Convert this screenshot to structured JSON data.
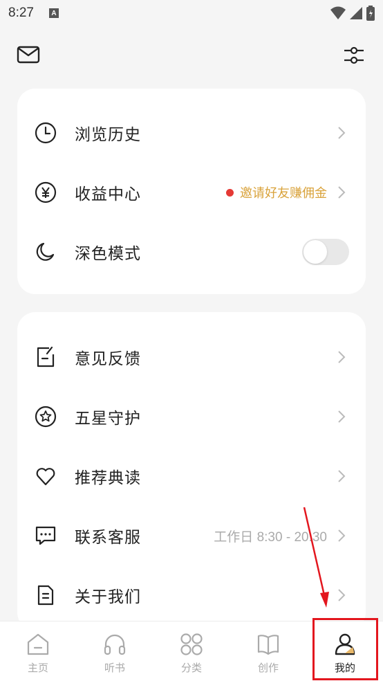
{
  "status_bar": {
    "time": "8:27",
    "notification_letter": "A"
  },
  "header": {
    "mail_icon": "mail-icon",
    "settings_icon": "sliders-icon"
  },
  "card1": {
    "items": [
      {
        "label": "浏览历史",
        "icon": "clock-icon"
      },
      {
        "label": "收益中心",
        "icon": "yen-icon",
        "extra": "邀请好友赚佣金"
      },
      {
        "label": "深色模式",
        "icon": "moon-icon",
        "toggle_on": false
      }
    ]
  },
  "card2": {
    "items": [
      {
        "label": "意见反馈",
        "icon": "feedback-icon"
      },
      {
        "label": "五星守护",
        "icon": "star-icon"
      },
      {
        "label": "推荐典读",
        "icon": "heart-icon"
      },
      {
        "label": "联系客服",
        "icon": "chat-icon",
        "extra": "工作日 8:30 - 20:30"
      },
      {
        "label": "关于我们",
        "icon": "document-icon"
      }
    ]
  },
  "tabbar": {
    "tabs": [
      {
        "label": "主页",
        "icon": "home-icon"
      },
      {
        "label": "听书",
        "icon": "headphones-icon"
      },
      {
        "label": "分类",
        "icon": "grid-icon"
      },
      {
        "label": "创作",
        "icon": "book-icon"
      },
      {
        "label": "我的",
        "icon": "profile-icon",
        "active": true
      }
    ]
  },
  "colors": {
    "accent_promo": "#d9a23a",
    "promo_dot": "#e53935",
    "annotation_red": "#e3161e"
  }
}
